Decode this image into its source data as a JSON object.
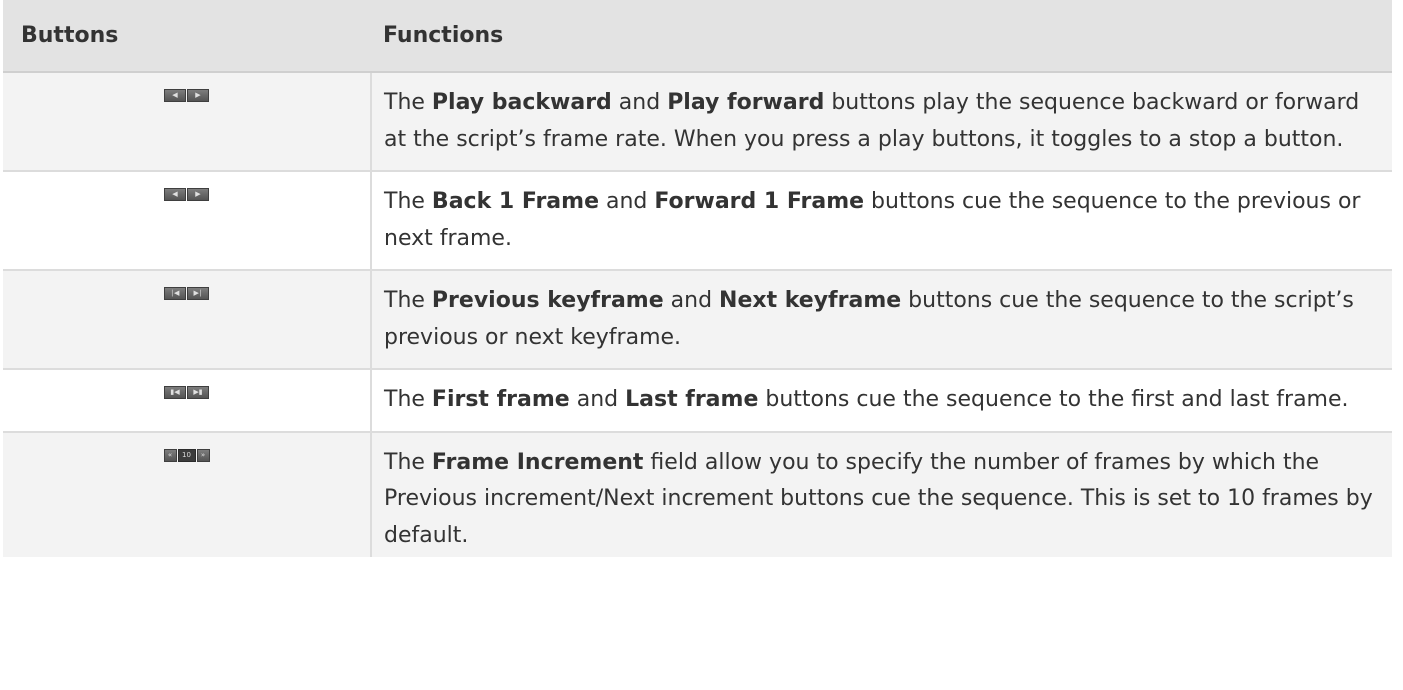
{
  "header": {
    "col1": "Buttons",
    "col2": "Functions"
  },
  "rows": [
    {
      "icons": [
        "play-backward-icon",
        "play-forward-icon"
      ],
      "t1": "The ",
      "b1": "Play backward",
      "t2": " and ",
      "b2": "Play forward",
      "t3": " buttons play the sequence backward or forward at the script’s frame rate. When you press a play buttons, it toggles to a stop a button."
    },
    {
      "icons": [
        "back-one-frame-icon",
        "forward-one-frame-icon"
      ],
      "t1": "The ",
      "b1": "Back 1 Frame",
      "t2": " and ",
      "b2": "Forward 1 Frame",
      "t3": " buttons cue the sequence to the previous or next frame."
    },
    {
      "icons": [
        "previous-keyframe-icon",
        "next-keyframe-icon"
      ],
      "t1": "The ",
      "b1": "Previous keyframe",
      "t2": " and ",
      "b2": "Next keyframe",
      "t3": " buttons cue the sequence to the script’s previous or next keyframe."
    },
    {
      "icons": [
        "first-frame-icon",
        "last-frame-icon"
      ],
      "t1": "The ",
      "b1": "First frame",
      "t2": " and ",
      "b2": "Last frame",
      "t3": " buttons cue the sequence to the first and last frame."
    },
    {
      "icons": [
        "previous-increment-icon",
        "frame-increment-field",
        "next-increment-icon"
      ],
      "field_value": "10",
      "t1": "The ",
      "b1": "Frame Increment",
      "t2": " field allow you to specify the number of frames by which the Previous increment/Next increment buttons cue the sequence. This is set to 10 frames by default."
    }
  ]
}
